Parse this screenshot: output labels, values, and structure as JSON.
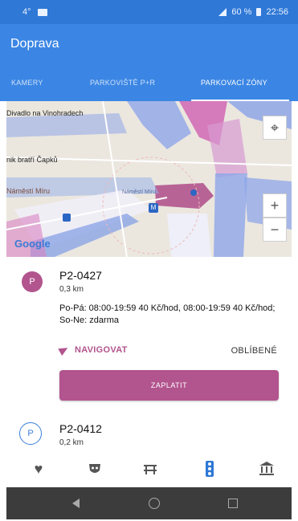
{
  "status_bar": {
    "left_text": "4°",
    "battery": "60 %",
    "time": "22:56"
  },
  "app_bar": {
    "title": "Doprava"
  },
  "tabs": [
    {
      "label": "KAMERY",
      "active": false
    },
    {
      "label": "PARKOVIŠTĚ P+R",
      "active": false
    },
    {
      "label": "PARKOVACÍ ZÓNY",
      "active": true
    }
  ],
  "map": {
    "labels": {
      "divadlo": "Divadlo na Vinohradech",
      "kostel": "nik bratří Čapků",
      "namesti": "Náměstí Míru",
      "street": "Náměstí Míru",
      "google": "Google"
    },
    "buttons": {
      "zoom_in": "+",
      "zoom_out": "−"
    }
  },
  "zones": [
    {
      "badge": "P",
      "code": "P2-0427",
      "distance": "0,3 km",
      "description": "Po-Pá: 08:00-19:59 40 Kč/hod, 08:00-19:59 40 Kč/hod; So-Ne: zdarma",
      "navigate_label": "NAVIGOVAT",
      "favorite_label": "OBLÍBENÉ",
      "pay_label": "ZAPLATIT"
    },
    {
      "badge": "P",
      "code": "P2-0412",
      "distance": "0,2 km"
    }
  ],
  "colors": {
    "primary": "#3b86e4",
    "accent": "#b2548e"
  },
  "bottom_nav": [
    "heart-icon",
    "mask-icon",
    "bench-icon",
    "traffic-light-icon",
    "museum-icon"
  ]
}
